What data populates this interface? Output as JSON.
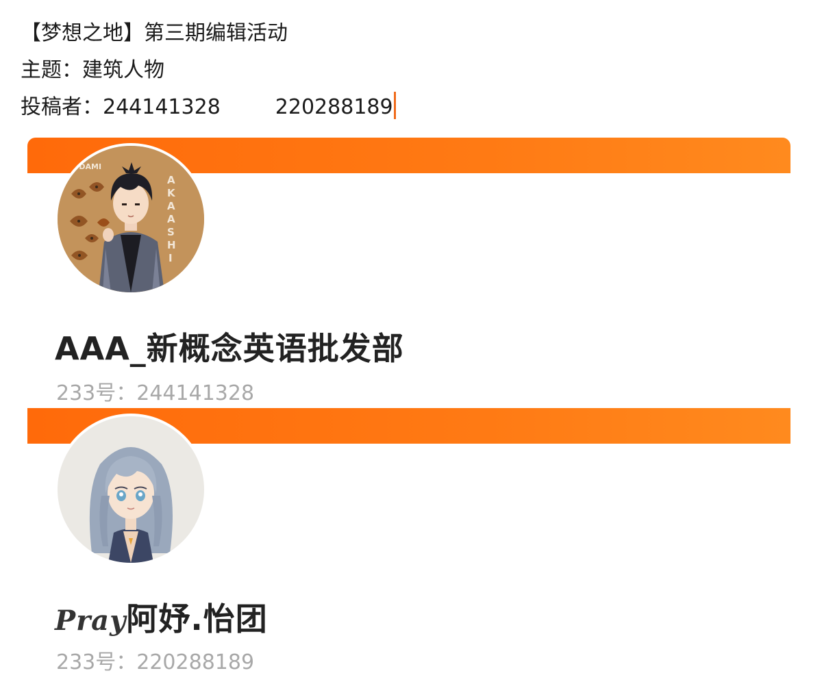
{
  "post": {
    "title": "【梦想之地】第三期编辑活动",
    "theme": "主题：建筑人物",
    "contributors_label": "投稿者：",
    "contributor_1": "244141328",
    "contributor_2": "220288189"
  },
  "profiles": [
    {
      "username": "AAA_新概念英语批发部",
      "uid": "233号：244141328",
      "avatar_badge_text": "KODAMI",
      "avatar_side_text": "AKAASHI"
    },
    {
      "username_prefix": "Pray",
      "username": "阿妤.怡团",
      "uid": "233号：220288189"
    }
  ],
  "colors": {
    "banner": "#ff7a14",
    "caret": "#f06a1a",
    "uid_text": "#a8a8a8"
  }
}
